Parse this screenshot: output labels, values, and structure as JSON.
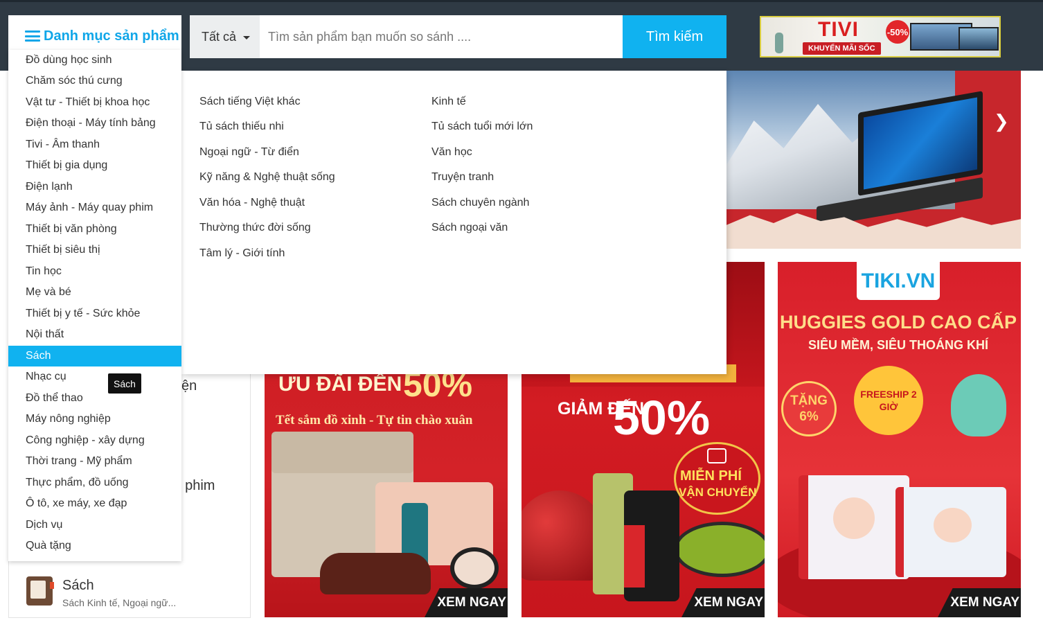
{
  "header": {
    "category_title": "Danh mục sản phẩm",
    "search_scope": "Tất cả",
    "search_placeholder": "Tìm sản phẩm bạn muốn so sánh ....",
    "search_button": "Tìm kiếm",
    "ad": {
      "title": "TIVI",
      "subtitle": "KHUYẾN MÃI SỐC",
      "discount": "-50%"
    }
  },
  "categories": [
    "Đồ dùng học sinh",
    "Chăm sóc thú cưng",
    "Vật tư - Thiết bị khoa học",
    "Điện thoại - Máy tính bảng",
    "Tivi - Âm thanh",
    "Thiết bị gia dụng",
    "Điện lạnh",
    "Máy ảnh - Máy quay phim",
    "Thiết bị văn phòng",
    "Thiết bị siêu thị",
    "Tin học",
    "Mẹ và bé",
    "Thiết bị y tế - Sức khỏe",
    "Nội thất",
    "Sách",
    "Nhạc cụ",
    "Đồ thể thao",
    "Máy nông nghiệp",
    "Công nghiệp - xây dựng",
    "Thời trang - Mỹ phẩm",
    "Thực phẩm, đồ uống",
    "Ô tô, xe máy, xe đạp",
    "Dịch vụ",
    "Quà tặng"
  ],
  "active_category": "Sách",
  "tooltip": "Sách",
  "submenu": {
    "col1": [
      "Sách tiếng Việt khác",
      "Tủ sách thiếu nhi",
      "Ngoại ngữ - Từ điển",
      "Kỹ năng & Nghệ thuật sống",
      "Văn hóa - Nghệ thuật",
      "Thường thức đời sống",
      "Tâm lý - Giới tính"
    ],
    "col2": [
      "Kinh tế",
      "Tủ sách tuổi mới lớn",
      "Văn học",
      "Truyện tranh",
      "Sách chuyên ngành",
      "Sách ngoại văn"
    ]
  },
  "hero": {
    "next_arrow": "❯"
  },
  "side_panel": {
    "peek1": "ện",
    "peek2": "/ phim",
    "book": {
      "title": "Sách",
      "subtitle": "Sách Kinh tế, Ngoại ngữ..."
    }
  },
  "promos": [
    {
      "headline": "ƯU ĐÃI ĐẾN",
      "percent": "50%",
      "subline": "Tết sắm đồ xinh - Tự tin chào xuân",
      "cta": "XEM NGAY"
    },
    {
      "headline": "GIẢM ĐẾN",
      "percent": "50%",
      "badge_line1": "MIỄN PHÍ",
      "badge_line2": "VẬN CHUYỂN",
      "cta": "XEM NGAY"
    },
    {
      "brand": "TIKI.VN",
      "headline": "HUGGIES GOLD CAO CẤP",
      "subline": "SIÊU MỀM, SIÊU THOÁNG KHÍ",
      "badge_left": "TẶNG 6%",
      "badge_center": "FREESHIP 2 GIỜ",
      "cta": "XEM NGAY"
    }
  ]
}
